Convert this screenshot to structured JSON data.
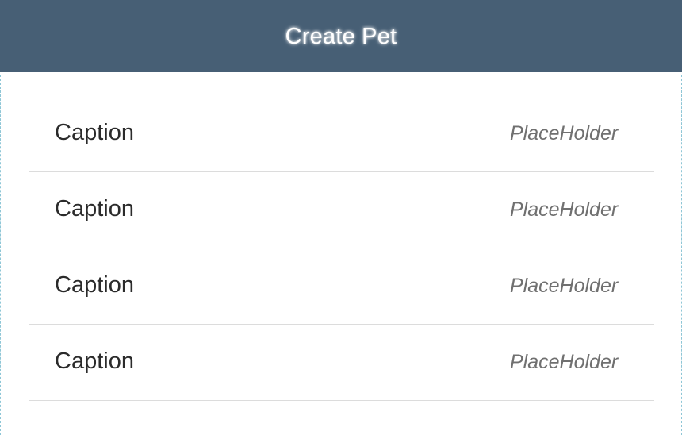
{
  "header": {
    "title": "Create Pet"
  },
  "form": {
    "rows": [
      {
        "caption": "Caption",
        "placeholder": "PlaceHolder"
      },
      {
        "caption": "Caption",
        "placeholder": "PlaceHolder"
      },
      {
        "caption": "Caption",
        "placeholder": "PlaceHolder"
      },
      {
        "caption": "Caption",
        "placeholder": "PlaceHolder"
      }
    ]
  },
  "colors": {
    "header_bg": "#475f75",
    "header_text": "#ffffff",
    "divider": "#dcdcdc",
    "dashed_outline": "#8ec6d6"
  }
}
